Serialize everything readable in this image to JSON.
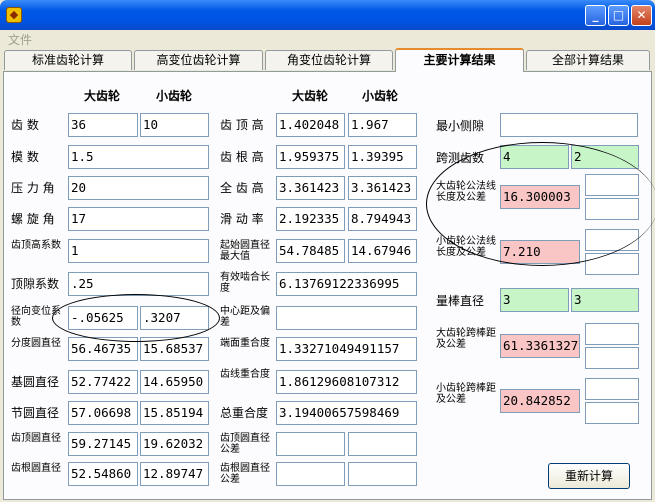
{
  "window": {
    "icon": "app-icon",
    "minimize": "_",
    "maximize": "□",
    "close": "✕"
  },
  "menu": {
    "file": "文件"
  },
  "tabs": [
    "标准齿轮计算",
    "高变位齿轮计算",
    "角变位齿轮计算",
    "主要计算结果",
    "全部计算结果"
  ],
  "headers": {
    "big1": "大齿轮",
    "small1": "小齿轮",
    "big2": "大齿轮",
    "small2": "小齿轮"
  },
  "col1": [
    {
      "label": "齿      数",
      "big": "36",
      "small": "10"
    },
    {
      "label": "模      数",
      "big": "1.5",
      "small": ""
    },
    {
      "label": "压 力 角",
      "big": "20",
      "small": ""
    },
    {
      "label": "螺 旋 角",
      "big": "17",
      "small": ""
    },
    {
      "label": "齿顶高系数",
      "big": "1",
      "small": ""
    },
    {
      "label": "顶隙系数",
      "big": ".25",
      "small": ""
    },
    {
      "label": "径向变位系数",
      "big": "-.05625",
      "small": ".3207"
    },
    {
      "label": "分度圆直径",
      "big": "56.46735",
      "small": "15.68537"
    },
    {
      "label": "基圆直径",
      "big": "52.77422",
      "small": "14.65950"
    },
    {
      "label": "节圆直径",
      "big": "57.06698",
      "small": "15.85194"
    },
    {
      "label": "齿顶圆直径",
      "big": "59.27145",
      "small": "19.62032"
    },
    {
      "label": "齿根圆直径",
      "big": "52.54860",
      "small": "12.89747"
    }
  ],
  "col2": [
    {
      "label": "齿 顶 高",
      "big": "1.402048",
      "small": "1.967"
    },
    {
      "label": "齿 根 高",
      "big": "1.959375",
      "small": "1.39395"
    },
    {
      "label": "全 齿 高",
      "big": "3.361423",
      "small": "3.361423"
    },
    {
      "label": "滑 动 率",
      "big": "2.192335",
      "small": "8.794943"
    },
    {
      "label": "起始圆直径最大值",
      "big": "54.78485",
      "small": "14.67946"
    },
    {
      "label": "有效啮合长度",
      "full": "6.13769122336995"
    },
    {
      "label": "中心距及偏差",
      "full": ""
    },
    {
      "label": "端面重合度",
      "full": "1.33271049491157"
    },
    {
      "label": "齿线重合度",
      "full": "1.86129608107312"
    },
    {
      "label": "总重合度",
      "full": "3.19400657598469"
    },
    {
      "label": "齿顶圆直径公差",
      "big": "",
      "small": ""
    },
    {
      "label": "齿根圆直径公差",
      "big": "",
      "small": ""
    }
  ],
  "col3": {
    "min_backlash": {
      "label": "最小侧隙",
      "value": ""
    },
    "span_teeth": {
      "label": "跨测齿数",
      "big": "4",
      "small": "2"
    },
    "big_normal_len": {
      "label": "大齿轮公法线长度及公差",
      "value": "16.300003",
      "tol1": "",
      "tol2": ""
    },
    "small_normal_len": {
      "label": "小齿轮公法线长度及公差",
      "value": "7.210",
      "tol1": "",
      "tol2": ""
    },
    "pin_dia": {
      "label": "量棒直径",
      "big": "3",
      "small": "3"
    },
    "big_pin_span": {
      "label": "大齿轮跨棒距及公差",
      "value": "61.3361327",
      "tol1": "",
      "tol2": ""
    },
    "small_pin_span": {
      "label": "小齿轮跨棒距及公差",
      "value": "20.842852",
      "tol1": "",
      "tol2": ""
    }
  },
  "recalc_button": "重新计算",
  "colors": {
    "green": "#c8f5c8",
    "pink": "#f9c5c5",
    "tab_accent": "#e68b2c",
    "titlebar": "#0054e3"
  }
}
